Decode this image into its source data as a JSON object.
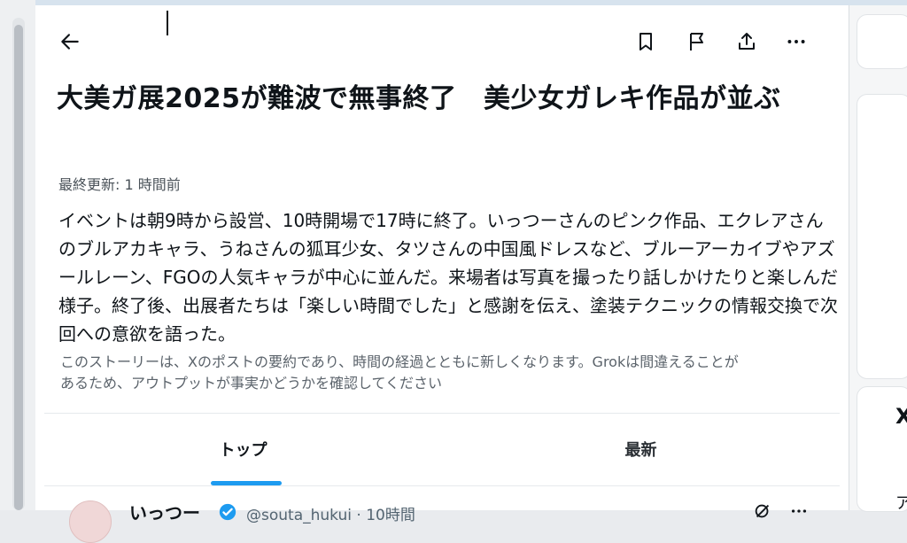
{
  "header": {
    "back_label": "←",
    "icons": [
      "back-arrow-icon",
      "bookmark-icon",
      "flag-icon",
      "share-icon",
      "more-icon"
    ]
  },
  "article": {
    "title": "大美ガ展2025が難波で無事終了　美少女ガレキ作品が並ぶ",
    "updated": "最終更新: 1 時間前",
    "body": "イベントは朝9時から設営、10時開場で17時に終了。いっつーさんのピンク作品、エクレアさんのブルアカキャラ、うねさんの狐耳少女、タツさんの中国風ドレスなど、ブルーアーカイブやアズールレーン、FGOの人気キャラが中心に並んだ。来場者は写真を撮ったり話しかけたりと楽しんだ様子。終了後、出展者たちは「楽しい時間でした」と感謝を伝え、塗装テクニックの情報交換で次回への意欲を語った。",
    "disclaimer": "このストーリーは、Xのポストの要約であり、時間の経過とともに新しくなります。Grokは間違えることがあるため、アウトプットが事実かどうかを確認してください"
  },
  "tabs": [
    {
      "label": "トップ",
      "active": true
    },
    {
      "label": "最新",
      "active": false
    }
  ],
  "post": {
    "name": "いっつー",
    "handle_time": "@souta_hukui · 10時間"
  },
  "right_panel": {
    "x_label": "X",
    "a_label": "ア"
  },
  "colors": {
    "accent": "#1d9bf0",
    "text": "#0f1419",
    "muted": "#536471"
  }
}
